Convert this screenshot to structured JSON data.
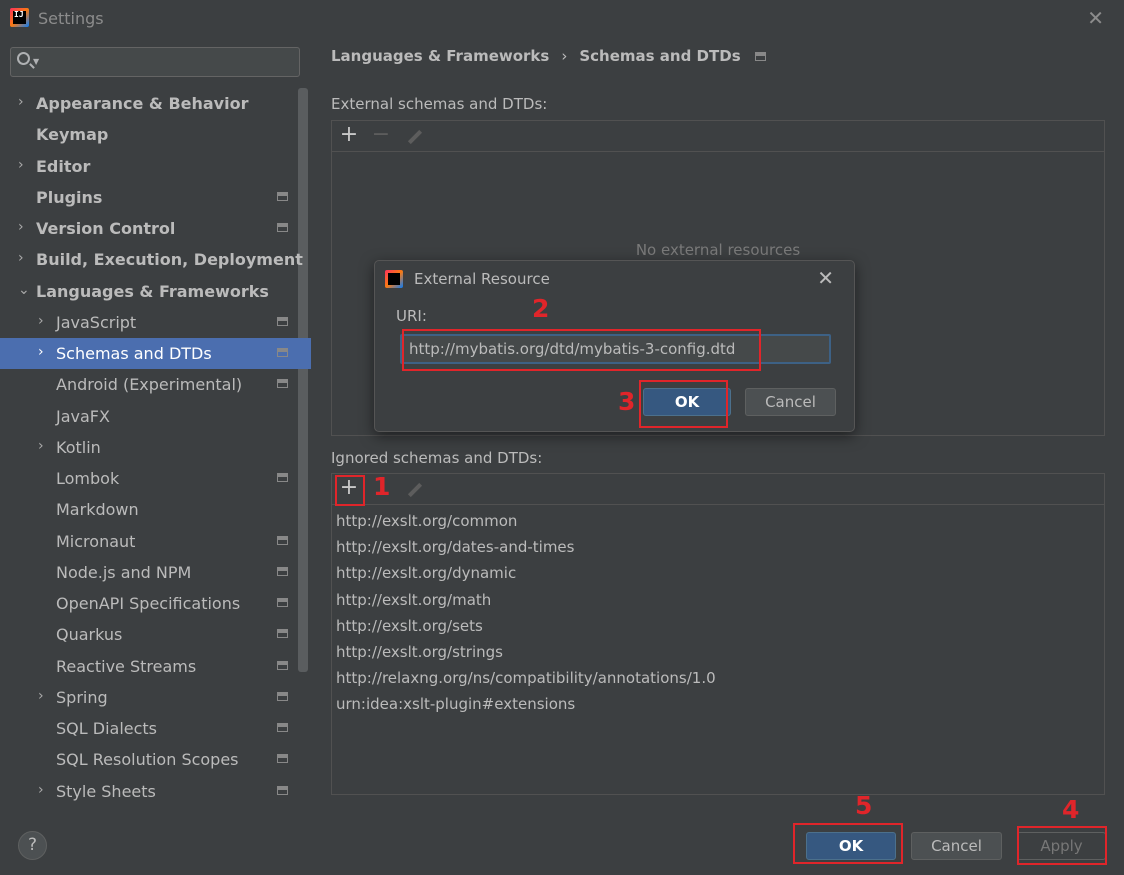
{
  "window": {
    "title": "Settings",
    "close_glyph": "✕"
  },
  "search": {
    "placeholder": ""
  },
  "sidebar": {
    "items": [
      {
        "label": "Appearance & Behavior",
        "arrow": "›",
        "bold": true,
        "indent": 0,
        "proj": false
      },
      {
        "label": "Keymap",
        "arrow": "",
        "bold": true,
        "indent": 0,
        "proj": false
      },
      {
        "label": "Editor",
        "arrow": "›",
        "bold": true,
        "indent": 0,
        "proj": false
      },
      {
        "label": "Plugins",
        "arrow": "",
        "bold": true,
        "indent": 0,
        "proj": true
      },
      {
        "label": "Version Control",
        "arrow": "›",
        "bold": true,
        "indent": 0,
        "proj": true
      },
      {
        "label": "Build, Execution, Deployment",
        "arrow": "›",
        "bold": true,
        "indent": 0,
        "proj": false
      },
      {
        "label": "Languages & Frameworks",
        "arrow": "⌄",
        "bold": true,
        "indent": 0,
        "proj": false
      },
      {
        "label": "JavaScript",
        "arrow": "›",
        "bold": false,
        "indent": 1,
        "proj": true
      },
      {
        "label": "Schemas and DTDs",
        "arrow": "›",
        "bold": false,
        "indent": 1,
        "proj": true,
        "selected": true
      },
      {
        "label": "Android (Experimental)",
        "arrow": "",
        "bold": false,
        "indent": 1,
        "proj": true
      },
      {
        "label": "JavaFX",
        "arrow": "",
        "bold": false,
        "indent": 1,
        "proj": false
      },
      {
        "label": "Kotlin",
        "arrow": "›",
        "bold": false,
        "indent": 1,
        "proj": false
      },
      {
        "label": "Lombok",
        "arrow": "",
        "bold": false,
        "indent": 1,
        "proj": true
      },
      {
        "label": "Markdown",
        "arrow": "",
        "bold": false,
        "indent": 1,
        "proj": false
      },
      {
        "label": "Micronaut",
        "arrow": "",
        "bold": false,
        "indent": 1,
        "proj": true
      },
      {
        "label": "Node.js and NPM",
        "arrow": "",
        "bold": false,
        "indent": 1,
        "proj": true
      },
      {
        "label": "OpenAPI Specifications",
        "arrow": "",
        "bold": false,
        "indent": 1,
        "proj": true
      },
      {
        "label": "Quarkus",
        "arrow": "",
        "bold": false,
        "indent": 1,
        "proj": true
      },
      {
        "label": "Reactive Streams",
        "arrow": "",
        "bold": false,
        "indent": 1,
        "proj": true
      },
      {
        "label": "Spring",
        "arrow": "›",
        "bold": false,
        "indent": 1,
        "proj": true
      },
      {
        "label": "SQL Dialects",
        "arrow": "",
        "bold": false,
        "indent": 1,
        "proj": true
      },
      {
        "label": "SQL Resolution Scopes",
        "arrow": "",
        "bold": false,
        "indent": 1,
        "proj": true
      },
      {
        "label": "Style Sheets",
        "arrow": "›",
        "bold": false,
        "indent": 1,
        "proj": true
      }
    ]
  },
  "breadcrumb": {
    "parent": "Languages & Frameworks",
    "separator": "›",
    "current": "Schemas and DTDs"
  },
  "external": {
    "label": "External schemas and DTDs:",
    "add": "+",
    "remove": "−",
    "empty_text": "No external resources"
  },
  "ignored": {
    "label": "Ignored schemas and DTDs:",
    "add": "+",
    "items": [
      "http://exslt.org/common",
      "http://exslt.org/dates-and-times",
      "http://exslt.org/dynamic",
      "http://exslt.org/math",
      "http://exslt.org/sets",
      "http://exslt.org/strings",
      "http://relaxng.org/ns/compatibility/annotations/1.0",
      "urn:idea:xslt-plugin#extensions"
    ]
  },
  "dialog": {
    "title": "External Resource",
    "close_glyph": "✕",
    "uri_label": "URI:",
    "uri_value": "http://mybatis.org/dtd/mybatis-3-config.dtd",
    "ok_label": "OK",
    "cancel_label": "Cancel"
  },
  "footer": {
    "help_label": "?",
    "ok_label": "OK",
    "cancel_label": "Cancel",
    "apply_label": "Apply"
  },
  "annotations": {
    "step1": "1",
    "step2": "2",
    "step3": "3",
    "step4": "4",
    "step5": "5",
    "color": "#e0252a"
  },
  "colors": {
    "background": "#3c3f41",
    "selection": "#4b6eaf",
    "primary_button": "#365880",
    "text": "#bbbbbb"
  }
}
